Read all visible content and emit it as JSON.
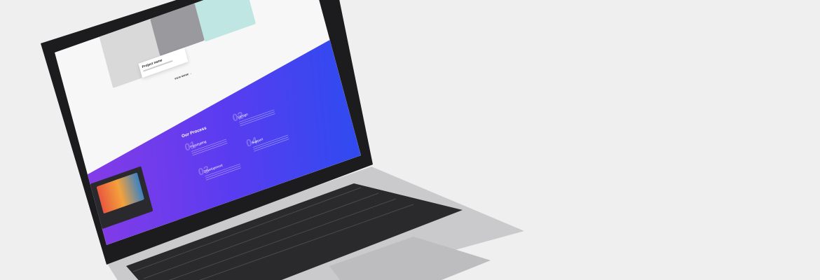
{
  "portfolio": {
    "card_title": "Project name",
    "view_more": "VIEW MORE →"
  },
  "process": {
    "title": "Our Process",
    "steps": [
      {
        "number": "01",
        "label": "Prototyping"
      },
      {
        "number": "02",
        "label": "Design"
      },
      {
        "number": "03",
        "label": "Development"
      },
      {
        "number": "04",
        "label": "Support"
      }
    ]
  },
  "colors": {
    "background": "#efefef",
    "gradient_start": "#8b3be6",
    "gradient_end": "#2f4bf0",
    "bezel": "#1c1c1e",
    "body": "#c9c9cb"
  }
}
